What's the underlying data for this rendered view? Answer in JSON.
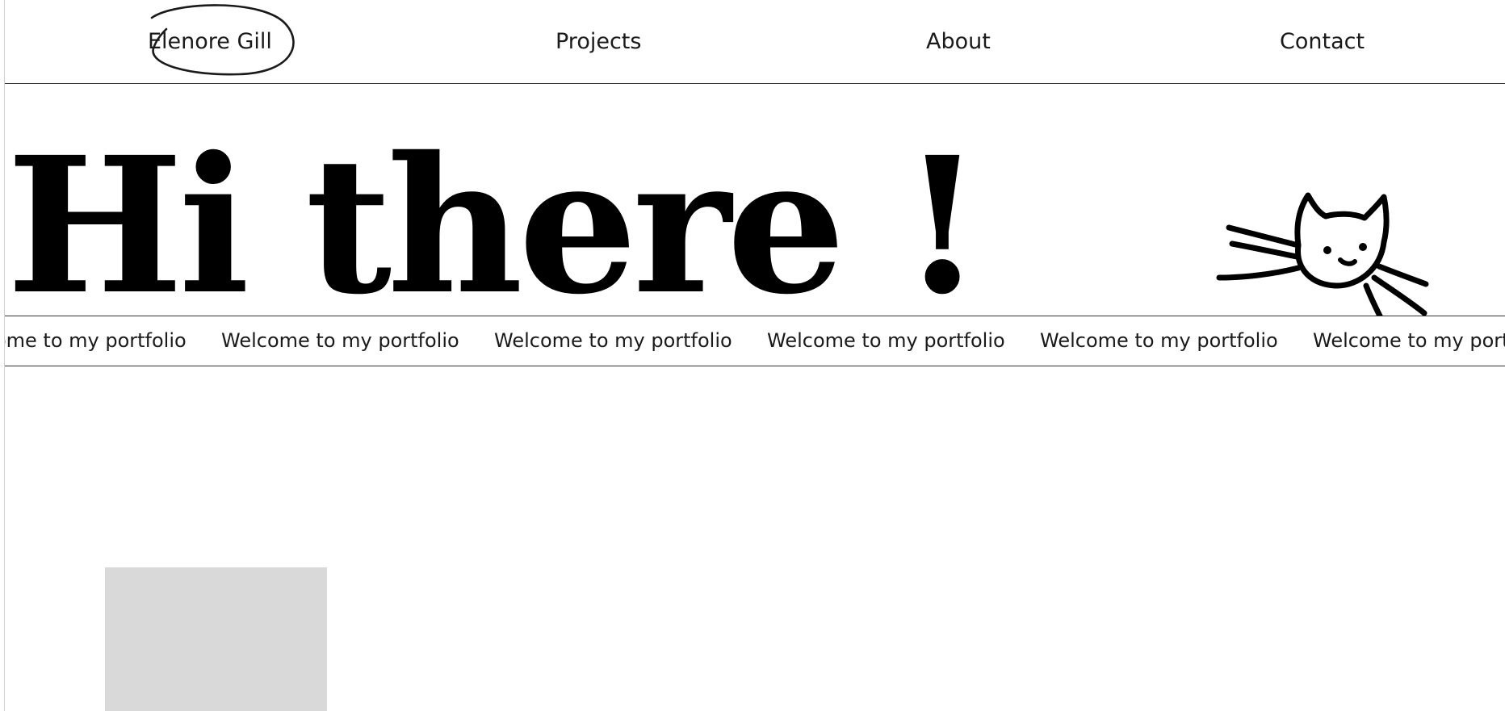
{
  "nav": {
    "brand": "Elenore Gill",
    "items": [
      {
        "label": "Projects"
      },
      {
        "label": "About"
      },
      {
        "label": "Contact"
      }
    ]
  },
  "hero": {
    "title": "Hi there !",
    "illustration": "cat-doodle-icon"
  },
  "marquee": {
    "items": [
      "Welcome to my portfolio",
      "Welcome to my portfolio",
      "Welcome to my portfolio",
      "Welcome to my portfolio",
      "Welcome to my portfolio",
      "Welcome to my portfolio"
    ]
  },
  "colors": {
    "text": "#1a1a1a",
    "placeholder": "#d9d9d9",
    "border": "#333333"
  }
}
